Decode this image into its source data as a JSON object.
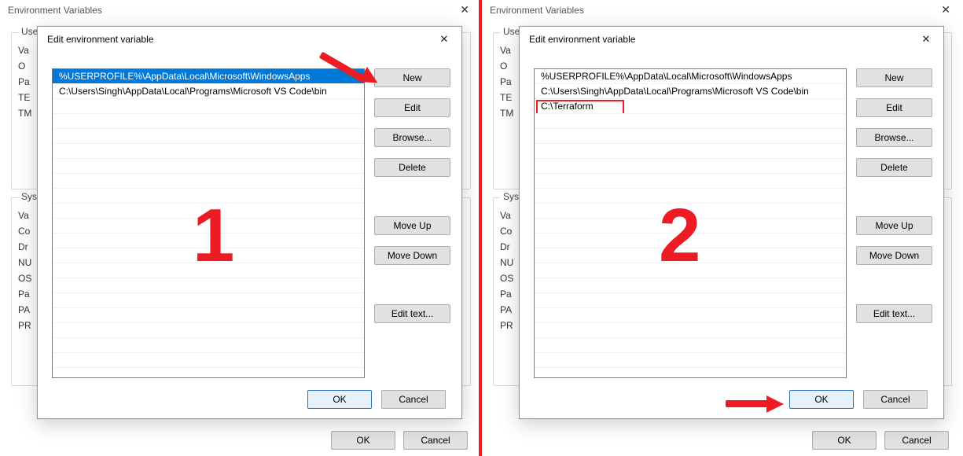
{
  "bg": {
    "title": "Environment Variables",
    "userGroup": "User",
    "sysGroup": "Syst",
    "userStubs": [
      "Va",
      "O",
      "Pa",
      "TE",
      "TM"
    ],
    "sysStubs": [
      "Va",
      "Co",
      "Dr",
      "NU",
      "OS",
      "Pa",
      "PA",
      "PR"
    ],
    "ok": "OK",
    "cancel": "Cancel"
  },
  "modal": {
    "title": "Edit environment variable",
    "buttons": {
      "new": "New",
      "edit": "Edit",
      "browse": "Browse...",
      "delete": "Delete",
      "moveUp": "Move Up",
      "moveDown": "Move Down",
      "editText": "Edit text..."
    },
    "ok": "OK",
    "cancel": "Cancel"
  },
  "left": {
    "rows": [
      "%USERPROFILE%\\AppData\\Local\\Microsoft\\WindowsApps",
      "C:\\Users\\Singh\\AppData\\Local\\Programs\\Microsoft VS Code\\bin"
    ],
    "selectedIndex": 0,
    "step": "1"
  },
  "right": {
    "rows": [
      "%USERPROFILE%\\AppData\\Local\\Microsoft\\WindowsApps",
      "C:\\Users\\Singh\\AppData\\Local\\Programs\\Microsoft VS Code\\bin",
      "C:\\Terraform"
    ],
    "boxedIndex": 2,
    "step": "2"
  }
}
